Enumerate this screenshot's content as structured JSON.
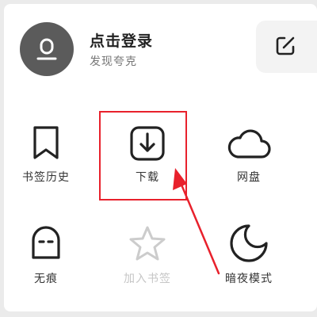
{
  "header": {
    "title": "点击登录",
    "subtitle": "发现夸克",
    "avatar_icon": "user-avatar-icon",
    "edit_icon": "edit-icon"
  },
  "grid": {
    "items": [
      {
        "label": "书签历史",
        "icon": "bookmark-icon",
        "enabled": true
      },
      {
        "label": "下载",
        "icon": "download-icon",
        "enabled": true
      },
      {
        "label": "网盘",
        "icon": "cloud-icon",
        "enabled": true
      },
      {
        "label": "无痕",
        "icon": "incognito-icon",
        "enabled": true
      },
      {
        "label": "加入书签",
        "icon": "star-icon",
        "enabled": false
      },
      {
        "label": "暗夜模式",
        "icon": "moon-icon",
        "enabled": true
      }
    ]
  },
  "colors": {
    "background": "#ebebeb",
    "panel": "#ffffff",
    "text": "#333333",
    "disabled_text": "#c6c6c6",
    "avatar": "#5b5b5b",
    "annotation": "#e8212c"
  }
}
